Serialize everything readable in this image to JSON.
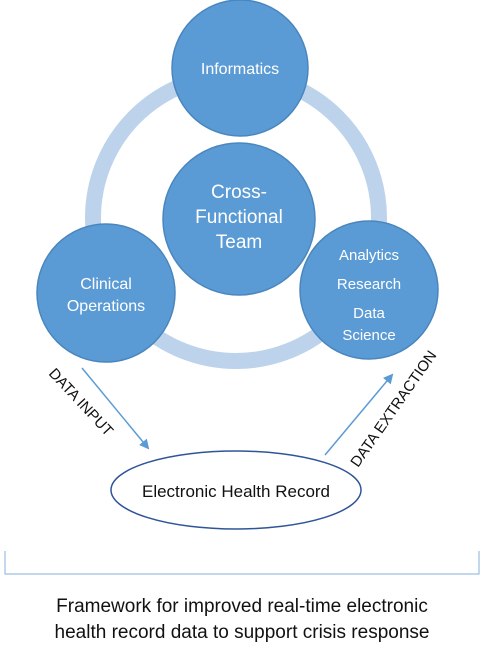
{
  "nodes": {
    "center": {
      "lines": [
        "Cross-",
        "Functional",
        "Team"
      ]
    },
    "top": {
      "lines": [
        "Informatics"
      ]
    },
    "left": {
      "lines": [
        "Clinical",
        "Operations"
      ]
    },
    "right": {
      "lines": [
        "Analytics",
        "Research",
        "Data",
        "Science"
      ]
    }
  },
  "ehr": {
    "label": "Electronic Health Record"
  },
  "arrows": {
    "input_label": "DATA INPUT",
    "extraction_label": "DATA EXTRACTION"
  },
  "caption": {
    "lines": [
      "Framework for improved real-time electronic",
      "health record data to support crisis response"
    ]
  },
  "colors": {
    "node_fill": "#5B9BD5",
    "node_stroke": "#4A86BE",
    "ring": "#BDD3EC",
    "arrow": "#5B9BD5",
    "ellipse_stroke": "#2F5597",
    "bracket": "#9BBFE3"
  }
}
